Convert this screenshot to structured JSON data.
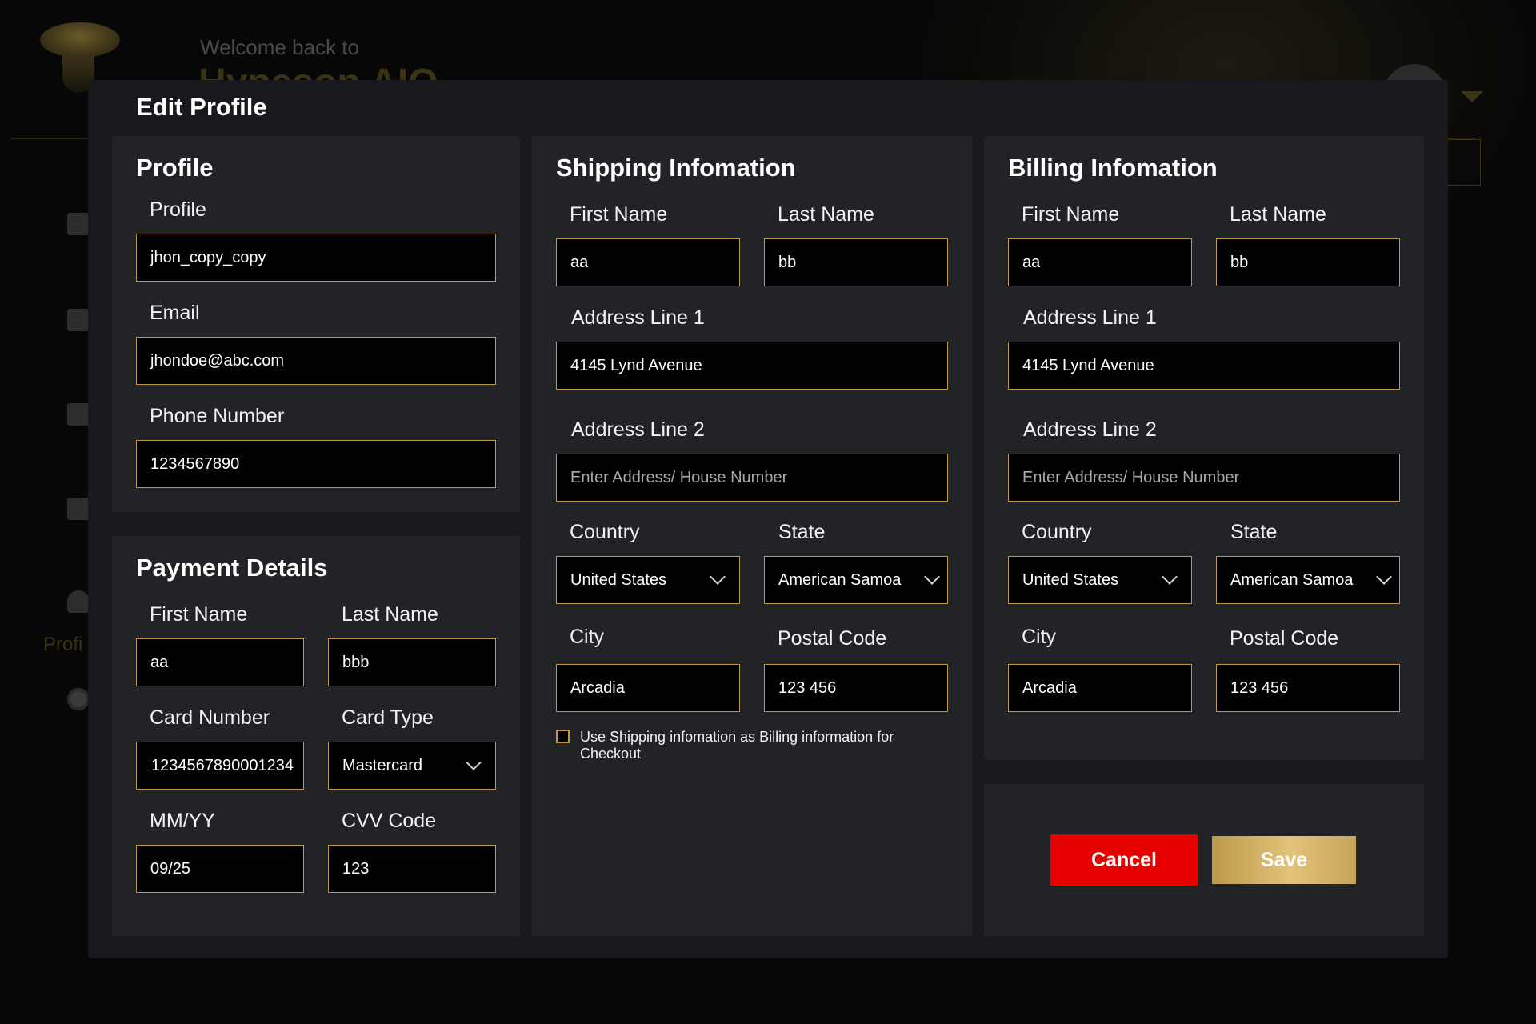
{
  "background": {
    "welcome_text": "Welcome back to",
    "brand_text": "Hypeson AIO",
    "sidebar_label": "Profi"
  },
  "modal": {
    "title": "Edit Profile"
  },
  "profile": {
    "section_title": "Profile",
    "profile_label": "Profile",
    "profile_value": "jhon_copy_copy",
    "email_label": "Email",
    "email_value": "jhondoe@abc.com",
    "phone_label": "Phone Number",
    "phone_value": "1234567890"
  },
  "payment": {
    "section_title": "Payment Details",
    "first_name_label": "First Name",
    "first_name_value": "aa",
    "last_name_label": "Last Name",
    "last_name_value": "bbb",
    "card_number_label": "Card Number",
    "card_number_value": "1234567890001234",
    "card_type_label": "Card Type",
    "card_type_value": "Mastercard",
    "expiry_label": "MM/YY",
    "expiry_value": "09/25",
    "cvv_label": "CVV Code",
    "cvv_value": "123"
  },
  "shipping": {
    "section_title": "Shipping Infomation",
    "first_name_label": "First Name",
    "first_name_value": "aa",
    "last_name_label": "Last Name",
    "last_name_value": "bb",
    "address1_label": "Address Line 1",
    "address1_value": "4145 Lynd Avenue",
    "address2_label": "Address Line 2",
    "address2_placeholder": "Enter Address/ House Number",
    "country_label": "Country",
    "country_value": "United States",
    "state_label": "State",
    "state_value": "American Samoa",
    "city_label": "City",
    "city_value": "Arcadia",
    "postal_label": "Postal Code",
    "postal_value": "123 456",
    "same_as_billing_text": "Use Shipping infomation as Billing information for Checkout",
    "same_as_billing_checked": false
  },
  "billing": {
    "section_title": "Billing Infomation",
    "first_name_label": "First Name",
    "first_name_value": "aa",
    "last_name_label": "Last Name",
    "last_name_value": "bb",
    "address1_label": "Address Line 1",
    "address1_value": "4145 Lynd Avenue",
    "address2_label": "Address Line 2",
    "address2_placeholder": "Enter Address/ House Number",
    "country_label": "Country",
    "country_value": "United States",
    "state_label": "State",
    "state_value": "American Samoa",
    "city_label": "City",
    "city_value": "Arcadia",
    "postal_label": "Postal Code",
    "postal_value": "123 456"
  },
  "actions": {
    "cancel_label": "Cancel",
    "save_label": "Save"
  },
  "colors": {
    "accent_gold": "#bf9a45",
    "cancel_red": "#e60000",
    "modal_bg": "#18191c",
    "panel_bg": "#222327"
  },
  "icons": {
    "dropdown": "chevron-down-icon",
    "checkbox": "checkbox-icon"
  }
}
